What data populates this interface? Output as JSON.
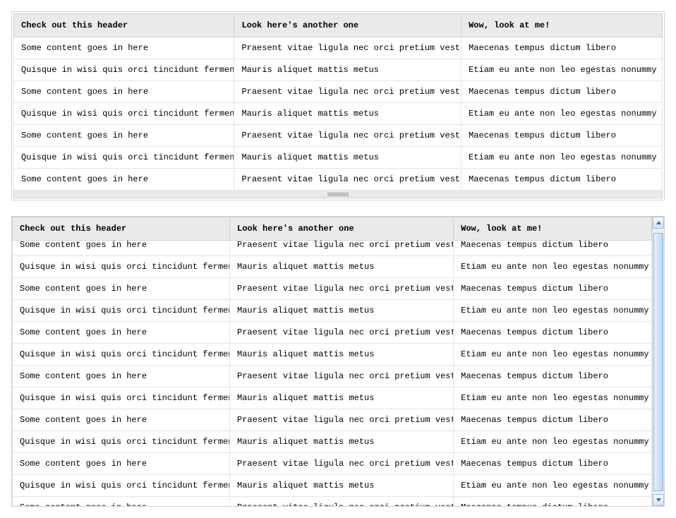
{
  "table1": {
    "headers": [
      "Check out this header",
      "Look here's another one",
      "Wow, look at me!"
    ],
    "rows": [
      [
        "Some content goes in here",
        "Praesent vitae ligula nec orci pretium vestibulum",
        "Maecenas tempus dictum libero"
      ],
      [
        "Quisque in wisi quis orci tincidunt fermentum",
        "Mauris aliquet mattis metus",
        "Etiam eu ante non leo egestas nonummy"
      ],
      [
        "Some content goes in here",
        "Praesent vitae ligula nec orci pretium vestibulum",
        "Maecenas tempus dictum libero"
      ],
      [
        "Quisque in wisi quis orci tincidunt fermentum",
        "Mauris aliquet mattis metus",
        "Etiam eu ante non leo egestas nonummy"
      ],
      [
        "Some content goes in here",
        "Praesent vitae ligula nec orci pretium vestibulum",
        "Maecenas tempus dictum libero"
      ],
      [
        "Quisque in wisi quis orci tincidunt fermentum",
        "Mauris aliquet mattis metus",
        "Etiam eu ante non leo egestas nonummy"
      ],
      [
        "Some content goes in here",
        "Praesent vitae ligula nec orci pretium vestibulum",
        "Maecenas tempus dictum libero"
      ]
    ]
  },
  "table2": {
    "headers": [
      "Check out this header",
      "Look here's another one",
      "Wow, look at me!"
    ],
    "rows": [
      [
        "Some content goes in here",
        "Praesent vitae ligula nec orci pretium vestibulum",
        "Maecenas tempus dictum libero"
      ],
      [
        "Quisque in wisi quis orci tincidunt fermentum",
        "Mauris aliquet mattis metus",
        "Etiam eu ante non leo egestas nonummy"
      ],
      [
        "Some content goes in here",
        "Praesent vitae ligula nec orci pretium vestibulum",
        "Maecenas tempus dictum libero"
      ],
      [
        "Quisque in wisi quis orci tincidunt fermentum",
        "Mauris aliquet mattis metus",
        "Etiam eu ante non leo egestas nonummy"
      ],
      [
        "Some content goes in here",
        "Praesent vitae ligula nec orci pretium vestibulum",
        "Maecenas tempus dictum libero"
      ],
      [
        "Quisque in wisi quis orci tincidunt fermentum",
        "Mauris aliquet mattis metus",
        "Etiam eu ante non leo egestas nonummy"
      ],
      [
        "Some content goes in here",
        "Praesent vitae ligula nec orci pretium vestibulum",
        "Maecenas tempus dictum libero"
      ],
      [
        "Quisque in wisi quis orci tincidunt fermentum",
        "Mauris aliquet mattis metus",
        "Etiam eu ante non leo egestas nonummy"
      ],
      [
        "Some content goes in here",
        "Praesent vitae ligula nec orci pretium vestibulum",
        "Maecenas tempus dictum libero"
      ],
      [
        "Quisque in wisi quis orci tincidunt fermentum",
        "Mauris aliquet mattis metus",
        "Etiam eu ante non leo egestas nonummy"
      ],
      [
        "Some content goes in here",
        "Praesent vitae ligula nec orci pretium vestibulum",
        "Maecenas tempus dictum libero"
      ],
      [
        "Quisque in wisi quis orci tincidunt fermentum",
        "Mauris aliquet mattis metus",
        "Etiam eu ante non leo egestas nonummy"
      ],
      [
        "Some content goes in here",
        "Praesent vitae ligula nec orci pretium vestibulum",
        "Maecenas tempus dictum libero"
      ]
    ]
  }
}
